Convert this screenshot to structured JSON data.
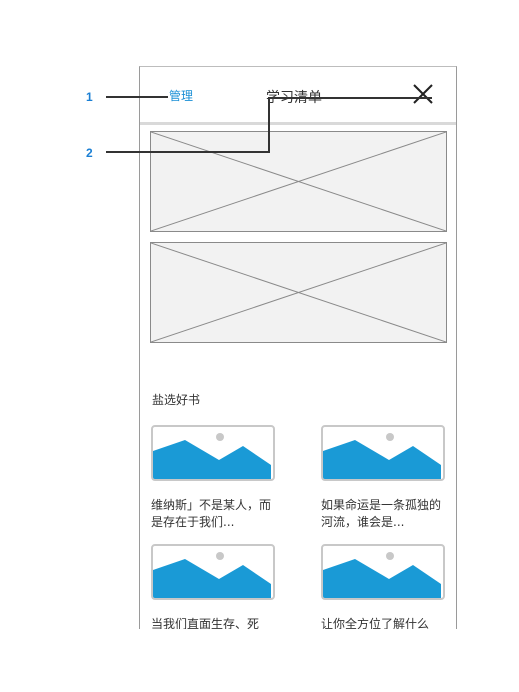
{
  "annotations": [
    {
      "number": "1"
    },
    {
      "number": "2"
    }
  ],
  "header": {
    "manage_label": "管理",
    "title": "学习清单",
    "close_icon": "close-icon"
  },
  "section": {
    "title": "盐选好书"
  },
  "books": [
    {
      "caption": "维纳斯」不是某人，而是存在于我们..."
    },
    {
      "caption": "如果命运是一条孤独的河流，谁会是..."
    },
    {
      "caption": "当我们直面生存、死"
    },
    {
      "caption": "让你全方位了解什么"
    }
  ],
  "colors": {
    "accent": "#1a8fd6",
    "annotation": "#1a7fd4",
    "image_placeholder": "#1a9ad6"
  }
}
